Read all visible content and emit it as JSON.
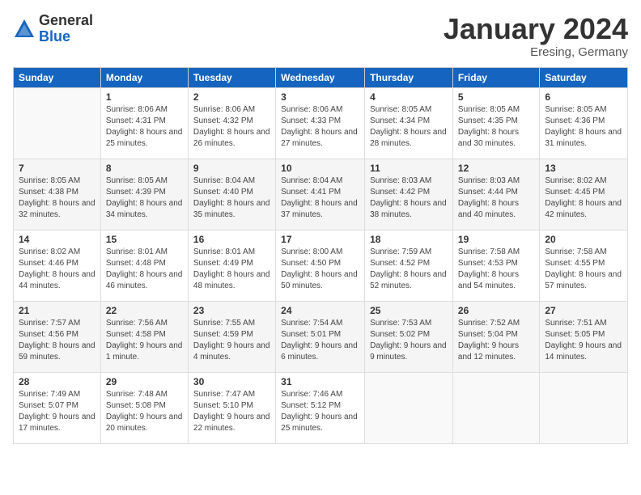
{
  "logo": {
    "general": "General",
    "blue": "Blue"
  },
  "title": "January 2024",
  "location": "Eresing, Germany",
  "days_header": [
    "Sunday",
    "Monday",
    "Tuesday",
    "Wednesday",
    "Thursday",
    "Friday",
    "Saturday"
  ],
  "weeks": [
    [
      {
        "day": "",
        "sunrise": "",
        "sunset": "",
        "daylight": ""
      },
      {
        "day": "1",
        "sunrise": "Sunrise: 8:06 AM",
        "sunset": "Sunset: 4:31 PM",
        "daylight": "Daylight: 8 hours and 25 minutes."
      },
      {
        "day": "2",
        "sunrise": "Sunrise: 8:06 AM",
        "sunset": "Sunset: 4:32 PM",
        "daylight": "Daylight: 8 hours and 26 minutes."
      },
      {
        "day": "3",
        "sunrise": "Sunrise: 8:06 AM",
        "sunset": "Sunset: 4:33 PM",
        "daylight": "Daylight: 8 hours and 27 minutes."
      },
      {
        "day": "4",
        "sunrise": "Sunrise: 8:05 AM",
        "sunset": "Sunset: 4:34 PM",
        "daylight": "Daylight: 8 hours and 28 minutes."
      },
      {
        "day": "5",
        "sunrise": "Sunrise: 8:05 AM",
        "sunset": "Sunset: 4:35 PM",
        "daylight": "Daylight: 8 hours and 30 minutes."
      },
      {
        "day": "6",
        "sunrise": "Sunrise: 8:05 AM",
        "sunset": "Sunset: 4:36 PM",
        "daylight": "Daylight: 8 hours and 31 minutes."
      }
    ],
    [
      {
        "day": "7",
        "sunrise": "Sunrise: 8:05 AM",
        "sunset": "Sunset: 4:38 PM",
        "daylight": "Daylight: 8 hours and 32 minutes."
      },
      {
        "day": "8",
        "sunrise": "Sunrise: 8:05 AM",
        "sunset": "Sunset: 4:39 PM",
        "daylight": "Daylight: 8 hours and 34 minutes."
      },
      {
        "day": "9",
        "sunrise": "Sunrise: 8:04 AM",
        "sunset": "Sunset: 4:40 PM",
        "daylight": "Daylight: 8 hours and 35 minutes."
      },
      {
        "day": "10",
        "sunrise": "Sunrise: 8:04 AM",
        "sunset": "Sunset: 4:41 PM",
        "daylight": "Daylight: 8 hours and 37 minutes."
      },
      {
        "day": "11",
        "sunrise": "Sunrise: 8:03 AM",
        "sunset": "Sunset: 4:42 PM",
        "daylight": "Daylight: 8 hours and 38 minutes."
      },
      {
        "day": "12",
        "sunrise": "Sunrise: 8:03 AM",
        "sunset": "Sunset: 4:44 PM",
        "daylight": "Daylight: 8 hours and 40 minutes."
      },
      {
        "day": "13",
        "sunrise": "Sunrise: 8:02 AM",
        "sunset": "Sunset: 4:45 PM",
        "daylight": "Daylight: 8 hours and 42 minutes."
      }
    ],
    [
      {
        "day": "14",
        "sunrise": "Sunrise: 8:02 AM",
        "sunset": "Sunset: 4:46 PM",
        "daylight": "Daylight: 8 hours and 44 minutes."
      },
      {
        "day": "15",
        "sunrise": "Sunrise: 8:01 AM",
        "sunset": "Sunset: 4:48 PM",
        "daylight": "Daylight: 8 hours and 46 minutes."
      },
      {
        "day": "16",
        "sunrise": "Sunrise: 8:01 AM",
        "sunset": "Sunset: 4:49 PM",
        "daylight": "Daylight: 8 hours and 48 minutes."
      },
      {
        "day": "17",
        "sunrise": "Sunrise: 8:00 AM",
        "sunset": "Sunset: 4:50 PM",
        "daylight": "Daylight: 8 hours and 50 minutes."
      },
      {
        "day": "18",
        "sunrise": "Sunrise: 7:59 AM",
        "sunset": "Sunset: 4:52 PM",
        "daylight": "Daylight: 8 hours and 52 minutes."
      },
      {
        "day": "19",
        "sunrise": "Sunrise: 7:58 AM",
        "sunset": "Sunset: 4:53 PM",
        "daylight": "Daylight: 8 hours and 54 minutes."
      },
      {
        "day": "20",
        "sunrise": "Sunrise: 7:58 AM",
        "sunset": "Sunset: 4:55 PM",
        "daylight": "Daylight: 8 hours and 57 minutes."
      }
    ],
    [
      {
        "day": "21",
        "sunrise": "Sunrise: 7:57 AM",
        "sunset": "Sunset: 4:56 PM",
        "daylight": "Daylight: 8 hours and 59 minutes."
      },
      {
        "day": "22",
        "sunrise": "Sunrise: 7:56 AM",
        "sunset": "Sunset: 4:58 PM",
        "daylight": "Daylight: 9 hours and 1 minute."
      },
      {
        "day": "23",
        "sunrise": "Sunrise: 7:55 AM",
        "sunset": "Sunset: 4:59 PM",
        "daylight": "Daylight: 9 hours and 4 minutes."
      },
      {
        "day": "24",
        "sunrise": "Sunrise: 7:54 AM",
        "sunset": "Sunset: 5:01 PM",
        "daylight": "Daylight: 9 hours and 6 minutes."
      },
      {
        "day": "25",
        "sunrise": "Sunrise: 7:53 AM",
        "sunset": "Sunset: 5:02 PM",
        "daylight": "Daylight: 9 hours and 9 minutes."
      },
      {
        "day": "26",
        "sunrise": "Sunrise: 7:52 AM",
        "sunset": "Sunset: 5:04 PM",
        "daylight": "Daylight: 9 hours and 12 minutes."
      },
      {
        "day": "27",
        "sunrise": "Sunrise: 7:51 AM",
        "sunset": "Sunset: 5:05 PM",
        "daylight": "Daylight: 9 hours and 14 minutes."
      }
    ],
    [
      {
        "day": "28",
        "sunrise": "Sunrise: 7:49 AM",
        "sunset": "Sunset: 5:07 PM",
        "daylight": "Daylight: 9 hours and 17 minutes."
      },
      {
        "day": "29",
        "sunrise": "Sunrise: 7:48 AM",
        "sunset": "Sunset: 5:08 PM",
        "daylight": "Daylight: 9 hours and 20 minutes."
      },
      {
        "day": "30",
        "sunrise": "Sunrise: 7:47 AM",
        "sunset": "Sunset: 5:10 PM",
        "daylight": "Daylight: 9 hours and 22 minutes."
      },
      {
        "day": "31",
        "sunrise": "Sunrise: 7:46 AM",
        "sunset": "Sunset: 5:12 PM",
        "daylight": "Daylight: 9 hours and 25 minutes."
      },
      {
        "day": "",
        "sunrise": "",
        "sunset": "",
        "daylight": ""
      },
      {
        "day": "",
        "sunrise": "",
        "sunset": "",
        "daylight": ""
      },
      {
        "day": "",
        "sunrise": "",
        "sunset": "",
        "daylight": ""
      }
    ]
  ]
}
